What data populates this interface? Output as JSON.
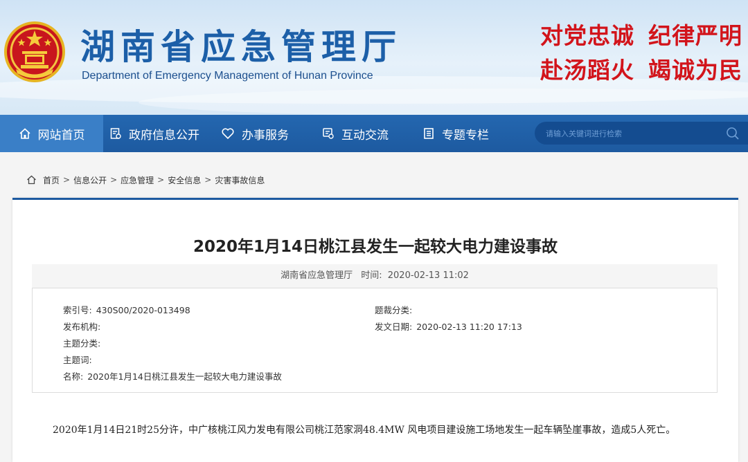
{
  "header": {
    "title": "湖南省应急管理厅",
    "subtitle": "Department of Emergency Management of Hunan Province",
    "slogan_line1": [
      "对党忠诚",
      "纪律严明"
    ],
    "slogan_line2": [
      "赴汤蹈火",
      "竭诚为民"
    ],
    "emblem_icon": "national-emblem-icon"
  },
  "nav": {
    "items": [
      {
        "label": "网站首页",
        "icon": "home-icon",
        "active": true
      },
      {
        "label": "政府信息公开",
        "icon": "document-icon",
        "active": false
      },
      {
        "label": "办事服务",
        "icon": "heart-icon",
        "active": false
      },
      {
        "label": "互动交流",
        "icon": "chat-icon",
        "active": false
      },
      {
        "label": "专题专栏",
        "icon": "list-icon",
        "active": false
      }
    ],
    "search_placeholder": "请输入关键词进行检索"
  },
  "breadcrumb": [
    "首页",
    "信息公开",
    "应急管理",
    "安全信息",
    "灾害事故信息"
  ],
  "article": {
    "title": "2020年1月14日桃江县发生一起较大电力建设事故",
    "source": "湖南省应急管理厅",
    "time_label": "时间:",
    "time": "2020-02-13 11:02",
    "info": {
      "index_label": "索引号:",
      "index": "430S00/2020-013498",
      "publisher_label": "发布机构:",
      "publisher": "",
      "topic_label": "主题分类:",
      "topic": "",
      "keywords_label": "主题词:",
      "keywords": "",
      "name_label": "名称:",
      "name": "2020年1月14日桃江县发生一起较大电力建设事故",
      "genre_label": "题裁分类:",
      "genre": "",
      "date_label": "发文日期:",
      "date": "2020-02-13 11:20 17:13"
    },
    "body": "2020年1月14日21时25分许，中广核桃江风力发电有限公司桃江范家洞48.4MW 风电项目建设施工场地发生一起车辆坠崖事故，造成5人死亡。"
  },
  "colors": {
    "nav_bg": "#1d5aa0",
    "nav_active": "#3a7fc7",
    "title_blue": "#1c5fa8",
    "slogan_red": "#d2141b"
  }
}
